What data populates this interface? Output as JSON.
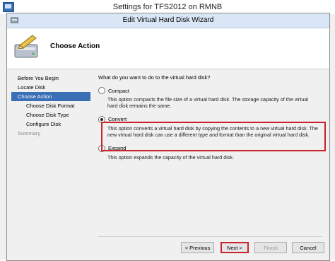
{
  "outer_window": {
    "title": "Settings for TFS2012 on RMNB"
  },
  "wizard": {
    "title": "Edit Virtual Hard Disk Wizard",
    "header_title": "Choose Action"
  },
  "nav": {
    "items": [
      {
        "label": "Before You Begin",
        "level": 0,
        "state": "normal"
      },
      {
        "label": "Locate Disk",
        "level": 0,
        "state": "normal"
      },
      {
        "label": "Choose Action",
        "level": 0,
        "state": "selected"
      },
      {
        "label": "Choose Disk Format",
        "level": 1,
        "state": "normal"
      },
      {
        "label": "Choose Disk Type",
        "level": 1,
        "state": "normal"
      },
      {
        "label": "Configure Disk",
        "level": 1,
        "state": "normal"
      },
      {
        "label": "Summary",
        "level": 0,
        "state": "disabled"
      }
    ]
  },
  "content": {
    "question": "What do you want to do to the virtual hard disk?",
    "options": [
      {
        "label": "Compact",
        "checked": false,
        "description": "This option compacts the file size of a virtual hard disk. The storage capacity of the virtual hard disk remains the same."
      },
      {
        "label": "Convert",
        "checked": true,
        "description": "This option converts a virtual hard disk by copying the contents to a new virtual hard disk. The new virtual hard disk can use a different type and format than the original virtual hard disk."
      },
      {
        "label": "Expand",
        "checked": false,
        "description": "This option expands the capacity of the virtual hard disk."
      }
    ]
  },
  "buttons": {
    "previous": "< Previous",
    "next": "Next >",
    "finish": "Finish",
    "cancel": "Cancel"
  },
  "colors": {
    "selected_nav": "#3a6fb5",
    "highlight_border": "#c8232c"
  }
}
